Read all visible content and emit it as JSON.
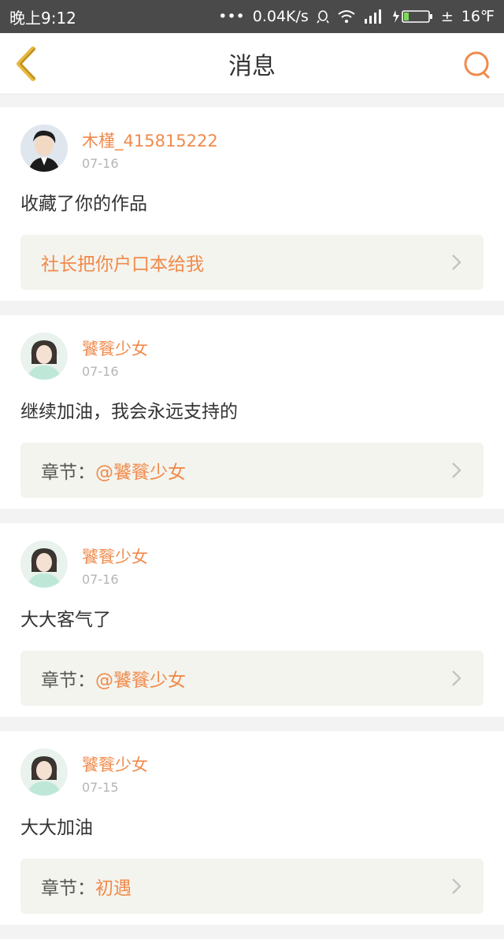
{
  "status_bar": {
    "time": "晚上9:12",
    "network_speed": "0.04K/s",
    "temperature": "16℉",
    "dots": "•••",
    "plusminus": "±"
  },
  "header": {
    "title": "消息",
    "back_icon": "chevron-left-icon",
    "search_icon": "search-icon"
  },
  "colors": {
    "accent": "#f08a4b",
    "back_icon": "#e8b840",
    "status_bar": "#4a4a4a"
  },
  "messages": [
    {
      "username": "木槿_415815222",
      "date": "07-16",
      "text": "收藏了你的作品",
      "ref_prefix": "",
      "ref_title": "社长把你户口本给我"
    },
    {
      "username": "饕餮少女",
      "date": "07-16",
      "text": "继续加油，我会永远支持的",
      "ref_prefix": "章节：",
      "ref_title": "@饕餮少女"
    },
    {
      "username": "饕餮少女",
      "date": "07-16",
      "text": "大大客气了",
      "ref_prefix": "章节：",
      "ref_title": "@饕餮少女"
    },
    {
      "username": "饕餮少女",
      "date": "07-15",
      "text": "大大加油",
      "ref_prefix": "章节：",
      "ref_title": "初遇"
    }
  ]
}
